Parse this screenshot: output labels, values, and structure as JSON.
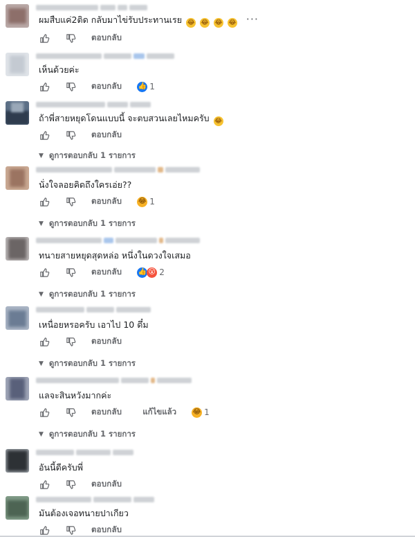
{
  "comments": [
    {
      "text": "ผมสืบแค่2ติด กลับมาไข่รับประทานเรย",
      "reply_label": "ตอบกลับ",
      "has_more": true,
      "more_label": "···",
      "trailing_emoji": [
        "haha-icon",
        "haha-icon",
        "haha-icon",
        "haha-icon"
      ]
    },
    {
      "text": "เห็นด้วยค่ะ",
      "reply_label": "ตอบกลับ",
      "reaction_count": "1",
      "reaction_icons": [
        "like-icon"
      ]
    },
    {
      "text": "ถ้าพี่สายหยุดโดนแบบนี้ จะตบสวนเลยไหมครับ",
      "reply_label": "ตอบกลับ",
      "trailing_emoji": [
        "haha-icon"
      ],
      "replies_label": "ดูการตอบกลับ 1 รายการ"
    },
    {
      "text": "นั่งใจลอยคิดถึงใครเอ่ย??",
      "reply_label": "ตอบกลับ",
      "reaction_count": "1",
      "reaction_icons": [
        "haha-icon"
      ],
      "replies_label": "ดูการตอบกลับ 1 รายการ"
    },
    {
      "text": "ทนายสายหยุดสุดหล่อ หนึ่งในดวงใจเสมอ",
      "reply_label": "ตอบกลับ",
      "reaction_count": "2",
      "reaction_icons": [
        "like-icon",
        "wow-icon"
      ],
      "replies_label": "ดูการตอบกลับ 1 รายการ"
    },
    {
      "text": "เหนื่อยหรอครับ เอาไป 10 ดึ๋ม",
      "reply_label": "ตอบกลับ",
      "replies_label": "ดูการตอบกลับ 1 รายการ"
    },
    {
      "text": "แลจะสินหวังมากค่ะ",
      "reply_label": "ตอบกลับ",
      "edited_label": "แก้ไขแล้ว",
      "reaction_count": "1",
      "reaction_icons": [
        "haha-icon"
      ],
      "replies_label": "ดูการตอบกลับ 1 รายการ"
    },
    {
      "text": "อันนี้ดีครับพี่",
      "reply_label": "ตอบกลับ"
    },
    {
      "text": "มันต้องเจอทนายปาเกียว",
      "reply_label": "ตอบกลับ"
    }
  ],
  "icons": {
    "like": "thumbs-up-icon",
    "dislike": "thumbs-down-icon",
    "chevron": "chevron-down-icon"
  },
  "colors": {
    "like_blue": "#1877f2",
    "haha_yellow": "#f7b125",
    "meta_gray": "#65676b"
  }
}
